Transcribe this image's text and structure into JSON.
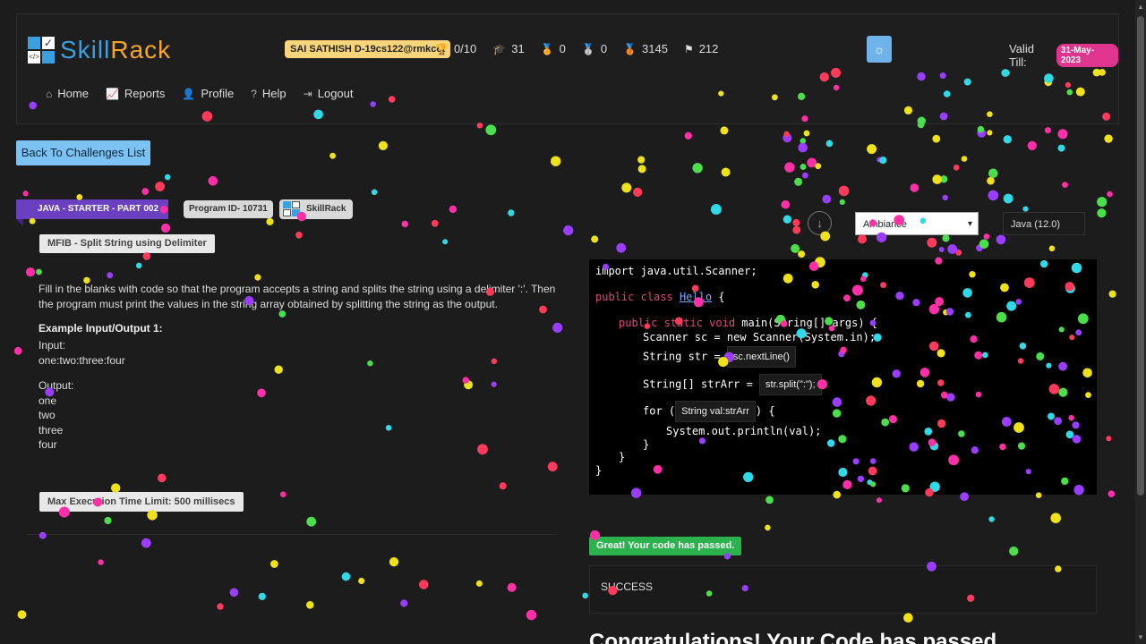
{
  "header": {
    "logo_text_a": "Skill",
    "logo_text_b": "Rack",
    "user": "SAI SATHISH D-19cs122@rmkcet",
    "stats": [
      {
        "icon": "trophy-icon",
        "glyph": "🏆",
        "value": "0/10"
      },
      {
        "icon": "graduation-cap-icon",
        "glyph": "🎓",
        "value": "31"
      },
      {
        "icon": "medal-gold-icon",
        "glyph": "🏅",
        "value": "0"
      },
      {
        "icon": "medal-silver-icon",
        "glyph": "🥈",
        "value": "0"
      },
      {
        "icon": "medal-bronze-icon",
        "glyph": "🥉",
        "value": "3145"
      },
      {
        "icon": "flag-icon",
        "glyph": "⚑",
        "value": "212"
      }
    ],
    "valid_label": "Valid Till:",
    "valid_date": "31-May-2023",
    "nav": [
      {
        "icon": "home-icon",
        "glyph": "⌂",
        "label": "Home"
      },
      {
        "icon": "reports-icon",
        "glyph": "📈",
        "label": "Reports"
      },
      {
        "icon": "profile-icon",
        "glyph": "👤",
        "label": "Profile"
      },
      {
        "icon": "help-icon",
        "glyph": "?",
        "label": "Help"
      },
      {
        "icon": "logout-icon",
        "glyph": "⇥",
        "label": "Logout"
      }
    ]
  },
  "challenge": {
    "back_label": "Back To Challenges List",
    "track": "JAVA - STARTER - PART 002",
    "program_id": "Program ID- 10731",
    "brand": "SkillRack",
    "title": "MFIB - Split String using Delimiter",
    "description": "Fill in the blanks with code so that the program accepts a string and splits the string using a delimiter ':'. Then the program must print the values in the string array obtained by splitting the string as the output.",
    "example_title": "Example Input/Output 1:",
    "input_label": "Input:",
    "input_value": "one:two:three:four",
    "output_label": "Output:",
    "output_lines": [
      "one",
      "two",
      "three",
      "four"
    ],
    "time_limit": "Max Execution Time Limit: 500 millisecs"
  },
  "editor": {
    "theme": "Ambiance",
    "language": "Java (12.0)",
    "code": {
      "l1": "import java.util.Scanner;",
      "l2_kw": "public class",
      "l2_cls": "Hello",
      "l2_end": " {",
      "l3_kw": "public static void",
      "l3_rest": " main(String[] args) {",
      "l4": "Scanner sc = new Scanner(System.in);",
      "l5": "String str = ",
      "blank1": "sc.nextLine()",
      "l6": "String[] strArr = ",
      "blank2": "str.split(\":\");",
      "l7a": "for (",
      "blank3": "String val:strArr",
      "l7b": ") {",
      "l8": "System.out.println(val);",
      "l9": "}",
      "l10": "}",
      "l11": "}"
    }
  },
  "result": {
    "badge": "Great! Your code has passed.",
    "status": "SUCCESS",
    "congrats": "Congratulations! Your Code has passed."
  },
  "colors": {
    "accent_blue": "#7cc2f2",
    "ribbon_purple": "#6a3fc0",
    "pass_green": "#2bb24c",
    "date_pink": "#e0358f",
    "user_yellow": "#f9d57a"
  }
}
